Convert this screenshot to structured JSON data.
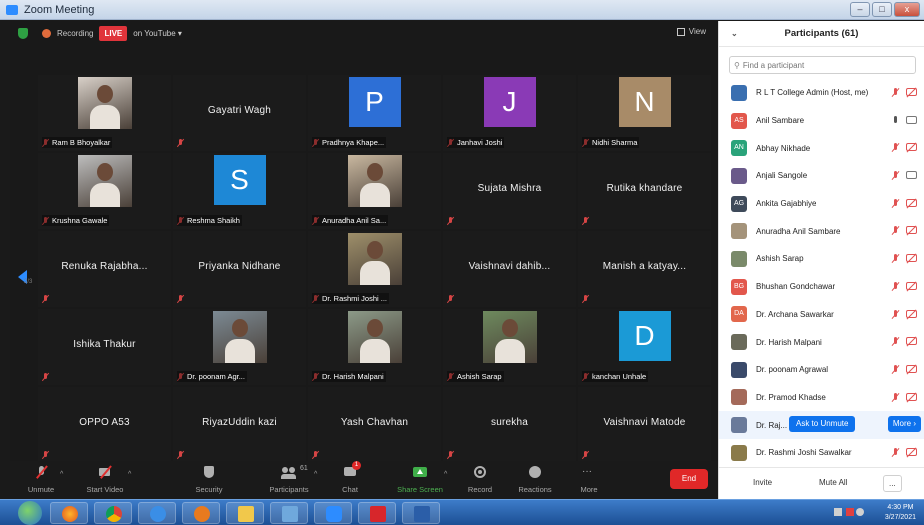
{
  "window": {
    "title": "Zoom Meeting",
    "buttons": [
      "–",
      "□",
      "x"
    ]
  },
  "topbar": {
    "recording": "Recording",
    "live": "LIVE",
    "youtube": "on YouTube ▾",
    "view": "View"
  },
  "gallery": {
    "page": "2/3",
    "tiles": [
      {
        "kind": "photo",
        "label": "Ram B Bhoyalkar",
        "bg": "#d8d0c8"
      },
      {
        "kind": "name",
        "name": "Gayatri Wagh"
      },
      {
        "kind": "letter",
        "letter": "P",
        "label": "Pradhnya Khape...",
        "color": "#2d6fd6"
      },
      {
        "kind": "letter",
        "letter": "J",
        "label": "Janhavi Joshi",
        "color": "#8a3ab6"
      },
      {
        "kind": "letter",
        "letter": "N",
        "label": "Nidhi Sharma",
        "color": "#a88b68"
      },
      {
        "kind": "photo",
        "label": "Krushna Gawale",
        "bg": "#bdbdbd"
      },
      {
        "kind": "letter",
        "letter": "S",
        "label": "Reshma Shaikh",
        "color": "#1e88d6"
      },
      {
        "kind": "photo",
        "label": "Anuradha Anil Sa...",
        "bg": "#c9b8a0"
      },
      {
        "kind": "name",
        "name": "Sujata Mishra"
      },
      {
        "kind": "name",
        "name": "Rutika khandare"
      },
      {
        "kind": "name",
        "name": "Renuka  Rajabha..."
      },
      {
        "kind": "name",
        "name": "Priyanka Nidhane"
      },
      {
        "kind": "photo",
        "label": "Dr. Rashmi Joshi ...",
        "bg": "#9e8f6a"
      },
      {
        "kind": "name",
        "name": "Vaishnavi  dahib..."
      },
      {
        "kind": "name",
        "name": "Manish  a  katyay..."
      },
      {
        "kind": "name",
        "name": "Ishika Thakur"
      },
      {
        "kind": "photo",
        "label": "Dr. poonam Agr...",
        "bg": "#7c8a94"
      },
      {
        "kind": "photo",
        "label": "Dr. Harish Malpani",
        "bg": "#8c9a88"
      },
      {
        "kind": "photo",
        "label": "Ashish Sarap",
        "bg": "#6e8a5e"
      },
      {
        "kind": "letter",
        "letter": "D",
        "label": "kanchan Unhale",
        "color": "#1b9ad6"
      },
      {
        "kind": "name",
        "name": "OPPO A53"
      },
      {
        "kind": "name",
        "name": "RiyazUddin kazi"
      },
      {
        "kind": "name",
        "name": "Yash Chavhan"
      },
      {
        "kind": "name",
        "name": "surekha"
      },
      {
        "kind": "name",
        "name": "Vaishnavi Matode"
      }
    ]
  },
  "toolbar": {
    "unmute": "Unmute",
    "start_video": "Start Video",
    "security": "Security",
    "participants": "Participants",
    "participants_count": "61",
    "chat": "Chat",
    "chat_badge": "1",
    "share_screen": "Share Screen",
    "record": "Record",
    "reactions": "Reactions",
    "more": "More",
    "end": "End"
  },
  "panel": {
    "title": "Participants (61)",
    "search_placeholder": "Find a participant",
    "participants": [
      {
        "initials": "",
        "name": "R L T College Admin (Host, me)",
        "color": "#3a6fb0",
        "mic": "off",
        "cam": "off"
      },
      {
        "initials": "AS",
        "name": "Anil Sambare",
        "color": "#e2574c",
        "mic": "on",
        "cam": "on"
      },
      {
        "initials": "AN",
        "name": "Abhay Nikhade",
        "color": "#2aa37a",
        "mic": "off",
        "cam": "off"
      },
      {
        "initials": "",
        "name": "Anjali Sangole",
        "color": "#6a5a8a",
        "mic": "off",
        "cam": "on"
      },
      {
        "initials": "AG",
        "name": "Ankita Gajabhiye",
        "color": "#3e4a5a",
        "mic": "off",
        "cam": "off"
      },
      {
        "initials": "",
        "name": "Anuradha Anil Sambare",
        "color": "#a4937a",
        "mic": "off",
        "cam": "off"
      },
      {
        "initials": "",
        "name": "Ashish Sarap",
        "color": "#7a8a6a",
        "mic": "off",
        "cam": "off"
      },
      {
        "initials": "BG",
        "name": "Bhushan Gondchawar",
        "color": "#e2574c",
        "mic": "off",
        "cam": "off"
      },
      {
        "initials": "DA",
        "name": "Dr. Archana Sawarkar",
        "color": "#e2674c",
        "mic": "off",
        "cam": "off"
      },
      {
        "initials": "",
        "name": "Dr. Harish Malpani",
        "color": "#6a6a5a",
        "mic": "off",
        "cam": "off"
      },
      {
        "initials": "",
        "name": "Dr. poonam Agrawal",
        "color": "#3a4a6a",
        "mic": "off",
        "cam": "off"
      },
      {
        "initials": "",
        "name": "Dr. Pramod Khadse",
        "color": "#a46a5a",
        "mic": "off",
        "cam": "off"
      },
      {
        "initials": "",
        "name": "Dr. Raj...",
        "color": "#6a7a9a",
        "mic": "",
        "cam": ""
      },
      {
        "initials": "",
        "name": "Dr. Rashmi Joshi Sawalkar",
        "color": "#8a7a4a",
        "mic": "off",
        "cam": "off"
      }
    ],
    "ask_to_unmute": "Ask to Unmute",
    "more": "More ›",
    "invite": "Invite",
    "mute_all": "Mute All",
    "ellipsis": "..."
  },
  "taskbar": {
    "time": "4:30 PM",
    "date": "3/27/2021"
  }
}
